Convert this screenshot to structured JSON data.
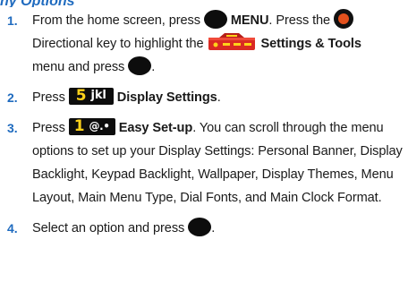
{
  "header_fragment": "ny Options",
  "steps": [
    {
      "number": "1.",
      "t1": "From the home screen, press",
      "menu_label": "MENU",
      "t2": ". Press the",
      "t3": "Directional key to highlight the",
      "settings_label": "Settings & Tools",
      "t4": "menu and press",
      "t5": "."
    },
    {
      "number": "2.",
      "t1": "Press",
      "key_digit": "5",
      "key_letters": "jkl",
      "label": "Display Settings",
      "t2": "."
    },
    {
      "number": "3.",
      "t1": "Press",
      "key_digit": "1",
      "key_letters": "@․•",
      "label": "Easy Set-up",
      "t2": ". You can scroll through the menu options to set up your Display Settings: Personal Banner, Display Backlight, Keypad Backlight, Wallpaper, Display Themes, Menu Layout, Main Menu Type, Dial Fonts, and Main Clock Format."
    },
    {
      "number": "4.",
      "t1": "Select an option and press",
      "t2": "."
    }
  ],
  "icons": {
    "ok_key": "ok-key-icon",
    "directional_key": "directional-key-icon",
    "settings_tools": "settings-tools-icon",
    "key5": "key-5-icon",
    "key1": "key-1-icon"
  },
  "colors": {
    "accent_blue": "#1f6bbf",
    "directional_orange": "#e4511d",
    "settings_red": "#d92a23"
  }
}
